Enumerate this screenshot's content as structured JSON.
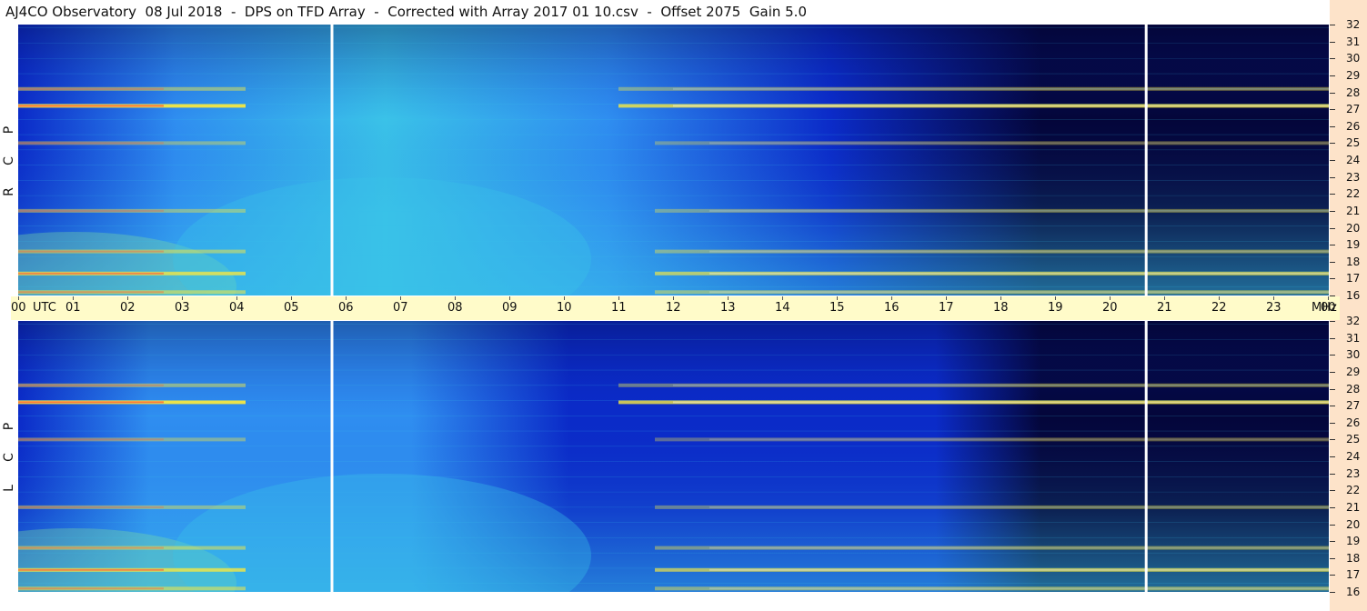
{
  "title": "AJ4CO Observatory  08 Jul 2018  -  DPS on TFD Array  -  Corrected with Array 2017 01 10.csv  -  Offset 2075  Gain 5.0",
  "chart_data": {
    "type": "heatmap",
    "title": "AJ4CO Observatory  08 Jul 2018  -  DPS on TFD Array  -  Corrected with Array 2017 01 10.csv  -  Offset 2075  Gain 5.0",
    "x_label": "UTC",
    "x_ticks": [
      "00",
      "01",
      "02",
      "03",
      "04",
      "05",
      "06",
      "07",
      "08",
      "09",
      "10",
      "11",
      "12",
      "13",
      "14",
      "15",
      "16",
      "17",
      "18",
      "19",
      "20",
      "21",
      "22",
      "23",
      "00"
    ],
    "y_label": "MHz",
    "y_range": [
      16,
      32
    ],
    "y_ticks": [
      32,
      31,
      30,
      29,
      28,
      27,
      26,
      25,
      24,
      23,
      22,
      21,
      20,
      19,
      18,
      17,
      16
    ],
    "panels": [
      {
        "name": "R C P",
        "letters": [
          "P",
          "C",
          "R"
        ]
      },
      {
        "name": "L C P",
        "letters": [
          "P",
          "C",
          "L"
        ]
      }
    ],
    "gaps_utc": [
      5.75,
      20.67
    ],
    "bright_bands_mhz": [
      {
        "mhz": 27.2,
        "intensity": 0.95
      },
      {
        "mhz": 28.2,
        "intensity": 0.5
      },
      {
        "mhz": 17.3,
        "intensity": 0.8
      },
      {
        "mhz": 18.6,
        "intensity": 0.5
      },
      {
        "mhz": 21.0,
        "intensity": 0.45
      },
      {
        "mhz": 25.0,
        "intensity": 0.4
      },
      {
        "mhz": 16.2,
        "intensity": 0.55
      }
    ],
    "colors": {
      "deep": "#04063a",
      "low": "#0b2bc8",
      "mid": "#2f8ef0",
      "cyan": "#3ac2e8",
      "high": "#7fe0a0",
      "hot": "#f5e742",
      "peak": "#ff5a3a",
      "white": "#ffffff"
    }
  }
}
